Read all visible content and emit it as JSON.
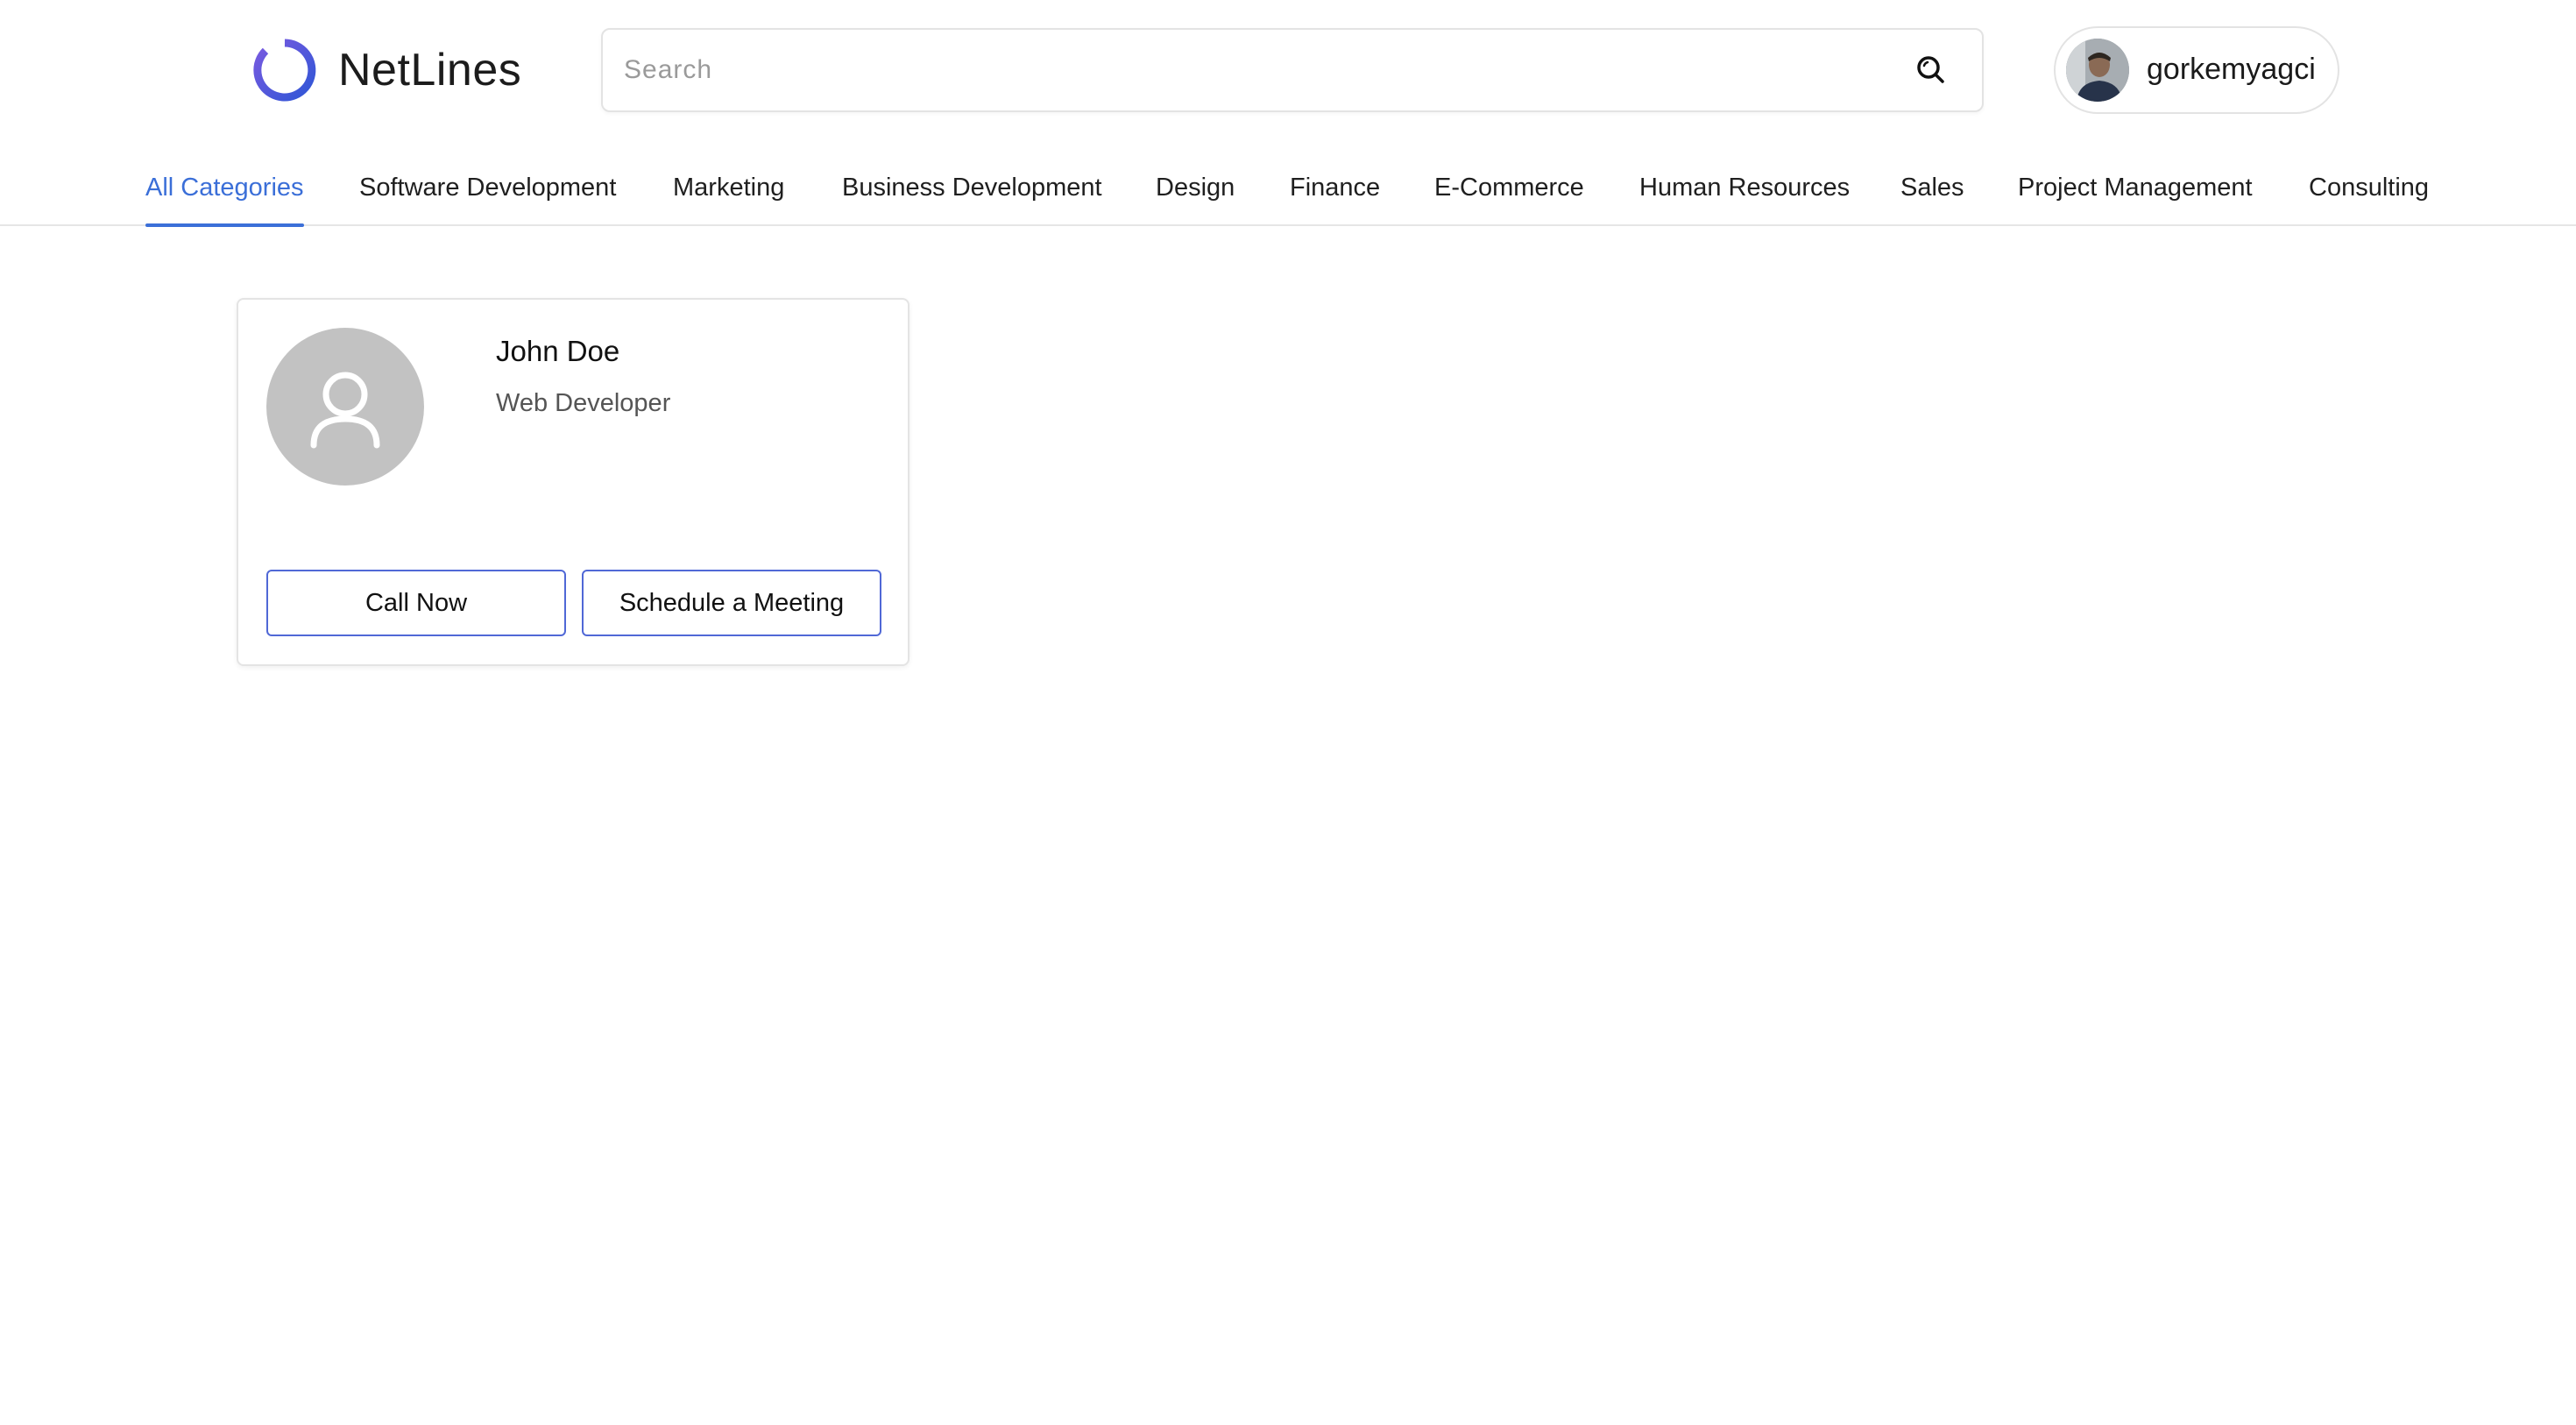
{
  "brand": {
    "name": "NetLines"
  },
  "search": {
    "placeholder": "Search",
    "value": ""
  },
  "user": {
    "username": "gorkemyagci"
  },
  "categories": [
    {
      "label": "All Categories",
      "active": true
    },
    {
      "label": "Software Development",
      "active": false
    },
    {
      "label": "Marketing",
      "active": false
    },
    {
      "label": "Business Development",
      "active": false
    },
    {
      "label": "Design",
      "active": false
    },
    {
      "label": "Finance",
      "active": false
    },
    {
      "label": "E-Commerce",
      "active": false
    },
    {
      "label": "Human Resources",
      "active": false
    },
    {
      "label": "Sales",
      "active": false
    },
    {
      "label": "Project Management",
      "active": false
    },
    {
      "label": "Consulting",
      "active": false
    }
  ],
  "profiles": [
    {
      "name": "John Doe",
      "title": "Web Developer",
      "call_label": "Call Now",
      "meeting_label": "Schedule a Meeting"
    }
  ],
  "colors": {
    "accent": "#3b6fd8",
    "button_border": "#5068d6",
    "avatar_placeholder": "#c2c2c2"
  },
  "icons": {
    "logo": "ring-logo-icon",
    "search": "search-icon",
    "user_avatar": "user-photo",
    "profile_avatar": "person-icon"
  }
}
